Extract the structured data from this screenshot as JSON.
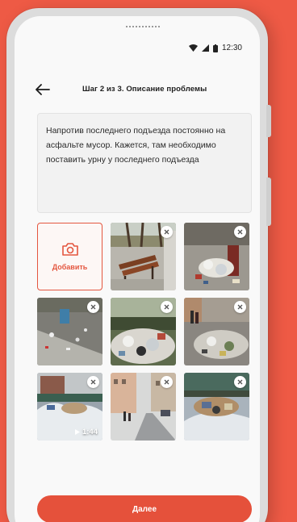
{
  "status_bar": {
    "time": "12:30"
  },
  "header": {
    "title": "Шаг 2 из 3.  Описание проблемы"
  },
  "description": {
    "text": "Напротив последнего подъезда постоянно на асфальте мусор. Кажется, там необходимо поставить урну у последнего подъезда"
  },
  "add_photo": {
    "label": "Добавить",
    "icon": "camera-icon"
  },
  "media": [
    {
      "kind": "photo",
      "subject": "bench-on-sidewalk"
    },
    {
      "kind": "photo",
      "subject": "overflowing-bin"
    },
    {
      "kind": "photo",
      "subject": "trash-on-ground"
    },
    {
      "kind": "photo",
      "subject": "garbage-pile"
    },
    {
      "kind": "photo",
      "subject": "street-litter"
    },
    {
      "kind": "video",
      "subject": "snow-and-garbage",
      "duration": "1:44"
    },
    {
      "kind": "photo",
      "subject": "winter-street"
    },
    {
      "kind": "photo",
      "subject": "snowy-trash-heap"
    }
  ],
  "footer": {
    "next_label": "Далее"
  },
  "colors": {
    "accent": "#e5513b",
    "background": "#ee5a45"
  }
}
